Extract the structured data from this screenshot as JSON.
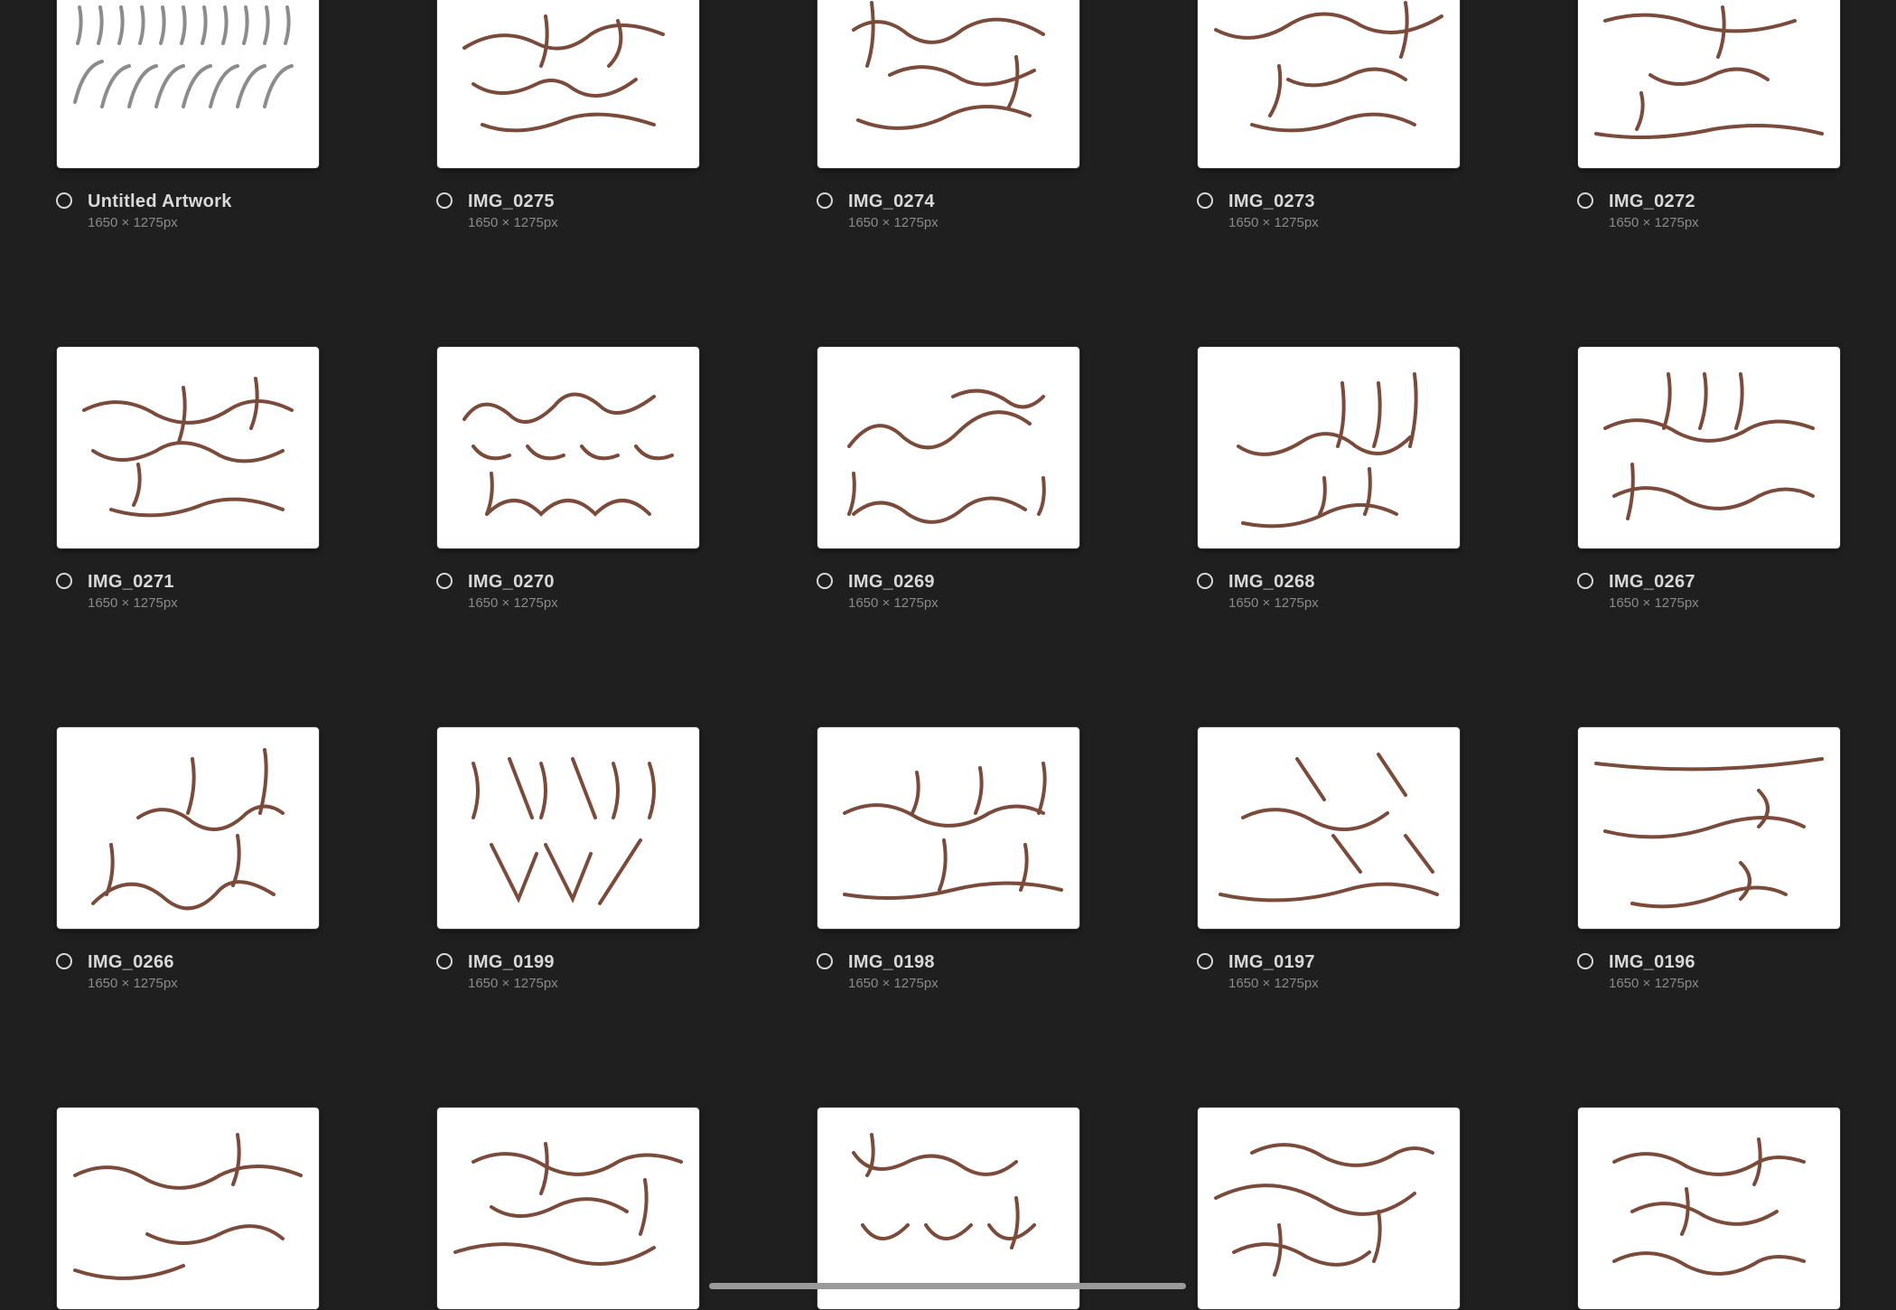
{
  "gallery": {
    "artworks": [
      {
        "title": "Untitled Artwork",
        "dimensions": "1650 × 1275px"
      },
      {
        "title": "IMG_0275",
        "dimensions": "1650 × 1275px"
      },
      {
        "title": "IMG_0274",
        "dimensions": "1650 × 1275px"
      },
      {
        "title": "IMG_0273",
        "dimensions": "1650 × 1275px"
      },
      {
        "title": "IMG_0272",
        "dimensions": "1650 × 1275px"
      },
      {
        "title": "IMG_0271",
        "dimensions": "1650 × 1275px"
      },
      {
        "title": "IMG_0270",
        "dimensions": "1650 × 1275px"
      },
      {
        "title": "IMG_0269",
        "dimensions": "1650 × 1275px"
      },
      {
        "title": "IMG_0268",
        "dimensions": "1650 × 1275px"
      },
      {
        "title": "IMG_0267",
        "dimensions": "1650 × 1275px"
      },
      {
        "title": "IMG_0266",
        "dimensions": "1650 × 1275px"
      },
      {
        "title": "IMG_0199",
        "dimensions": "1650 × 1275px"
      },
      {
        "title": "IMG_0198",
        "dimensions": "1650 × 1275px"
      },
      {
        "title": "IMG_0197",
        "dimensions": "1650 × 1275px"
      },
      {
        "title": "IMG_0196",
        "dimensions": "1650 × 1275px"
      },
      {
        "title": "",
        "dimensions": ""
      },
      {
        "title": "",
        "dimensions": ""
      },
      {
        "title": "",
        "dimensions": ""
      },
      {
        "title": "",
        "dimensions": ""
      },
      {
        "title": "",
        "dimensions": ""
      }
    ]
  },
  "colors": {
    "background": "#1f1f1f",
    "ink_brown": "#7a4a3a",
    "ink_gray": "#8c8c8c",
    "title_text": "#d9d9d9",
    "subtitle_text": "#8a8a8a"
  }
}
